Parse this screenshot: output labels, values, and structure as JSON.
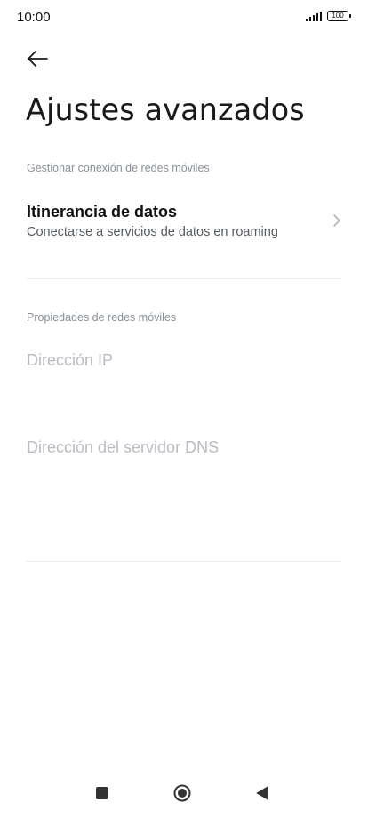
{
  "status_bar": {
    "time": "10:00",
    "battery": "100",
    "icons": [
      "signal-icon",
      "battery-icon"
    ]
  },
  "header": {
    "back_icon": "arrow-left-icon",
    "title": "Ajustes avanzados"
  },
  "sections": {
    "mobile_network_connection": {
      "header": "Gestionar conexión de redes móviles",
      "items": [
        {
          "title": "Itinerancia de datos",
          "subtitle": "Conectarse a servicios de datos en roaming",
          "icon": "chevron-right-icon"
        }
      ]
    },
    "mobile_network_properties": {
      "header": "Propiedades de redes móviles",
      "items": [
        {
          "title": "Dirección IP"
        },
        {
          "title": "Dirección del servidor DNS"
        }
      ]
    }
  },
  "nav_bar": {
    "icons": [
      "recents-square-icon",
      "home-circle-icon",
      "back-triangle-icon"
    ]
  },
  "colors": {
    "background": "#ffffff",
    "section_header": "#8a8f99",
    "disabled_text": "#b8bcc2",
    "divider": "#ececec"
  }
}
